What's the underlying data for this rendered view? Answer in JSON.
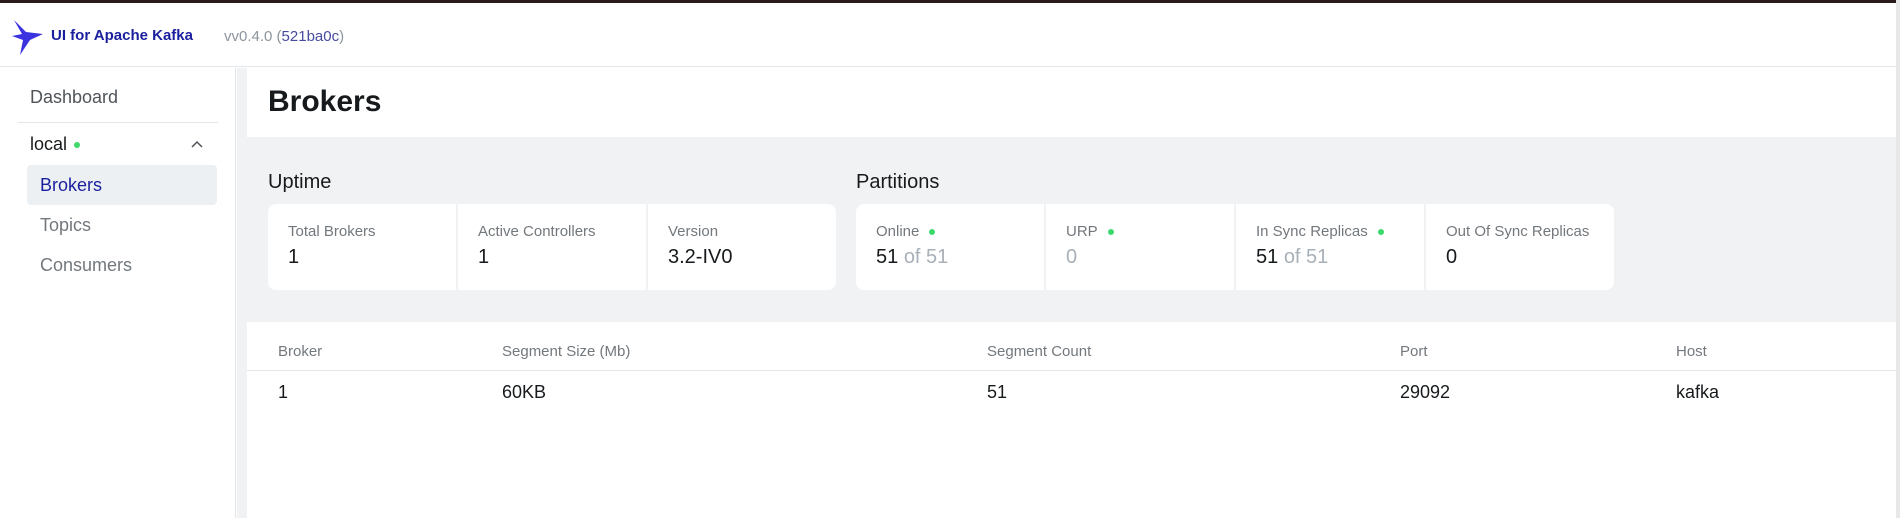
{
  "header": {
    "app_title": "UI for Apache Kafka",
    "version": "vv0.4.0",
    "commit": "521ba0c"
  },
  "sidebar": {
    "dashboard": "Dashboard",
    "cluster": {
      "name": "local",
      "status_color": "#3dd96b"
    },
    "items": [
      {
        "label": "Brokers",
        "active": true
      },
      {
        "label": "Topics",
        "active": false
      },
      {
        "label": "Consumers",
        "active": false
      }
    ]
  },
  "page": {
    "title": "Brokers"
  },
  "metrics": {
    "uptime": {
      "title": "Uptime",
      "cards": [
        {
          "label": "Total Brokers",
          "value": "1"
        },
        {
          "label": "Active Controllers",
          "value": "1"
        },
        {
          "label": "Version",
          "value": "3.2-IV0"
        }
      ]
    },
    "partitions": {
      "title": "Partitions",
      "cards": [
        {
          "label": "Online",
          "value": "51",
          "suffix": "of 51",
          "status": "green"
        },
        {
          "label": "URP",
          "value": "0",
          "status": "green"
        },
        {
          "label": "In Sync Replicas",
          "value": "51",
          "suffix": "of 51",
          "status": "green"
        },
        {
          "label": "Out Of Sync Replicas",
          "value": "0"
        }
      ]
    }
  },
  "table": {
    "headers": [
      "Broker",
      "Segment Size (Mb)",
      "Segment Count",
      "Port",
      "Host"
    ],
    "rows": [
      [
        "1",
        "60KB",
        "51",
        "29092",
        "kafka"
      ]
    ]
  },
  "colors": {
    "brand": "#1a1f9e",
    "status_ok": "#3dd96b",
    "muted": "#a8b0b8"
  },
  "icons": {
    "logo": "kafka-bird-logo",
    "chevron": "chevron-up-icon"
  }
}
